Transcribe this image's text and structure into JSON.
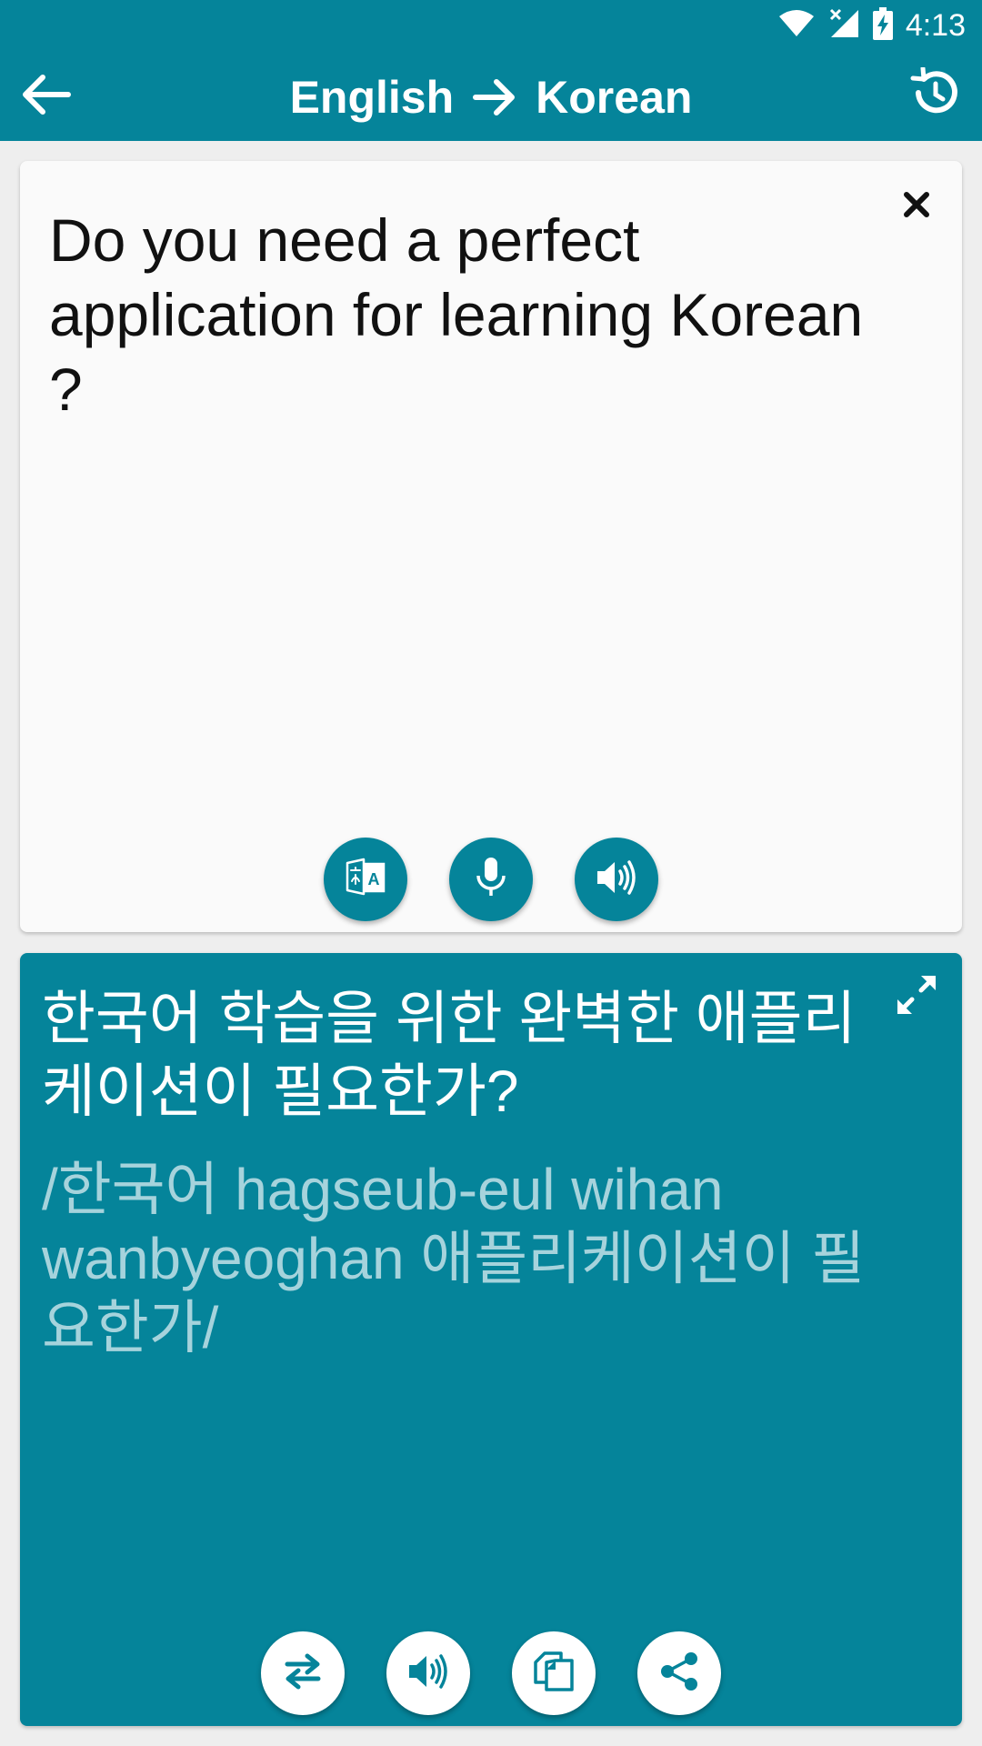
{
  "status_bar": {
    "time": "4:13",
    "icons": [
      "wifi-icon",
      "signal-off-icon",
      "battery-charging-icon"
    ]
  },
  "header": {
    "source_language": "English",
    "target_language": "Korean",
    "back_icon": "arrow-left-icon",
    "direction_icon": "arrow-right-icon",
    "history_icon": "history-icon"
  },
  "source_card": {
    "text": "Do you need a perfect application for learning Korean ?",
    "clear_icon": "close-icon",
    "actions": [
      "translate-icon",
      "microphone-icon",
      "speaker-icon"
    ]
  },
  "target_card": {
    "translation": "한국어 학습을 위한 완벽한 애플리케이션이 필요한가?",
    "romanization": "/한국어 hagseub-eul wihan wanbyeoghan 애플리케이션이 필요한가/",
    "expand_icon": "expand-icon",
    "actions": [
      "swap-icon",
      "speaker-icon",
      "copy-icon",
      "share-icon"
    ]
  },
  "colors": {
    "primary": "#05849a",
    "surface": "#fafafa",
    "romanization": "#a6d3dc"
  }
}
